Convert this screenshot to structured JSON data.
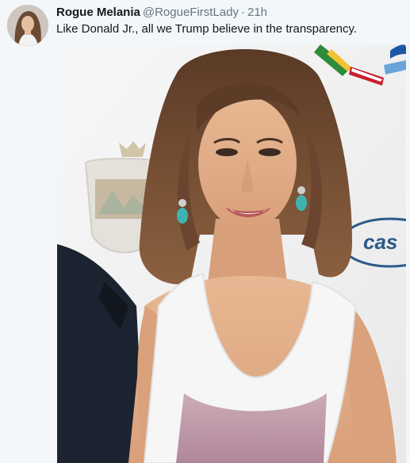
{
  "tweet": {
    "author_name": "Rogue Melania",
    "handle": "@RogueFirstLady",
    "separator": "·",
    "time": "21h",
    "text": "Like Donald Jr., all we Trump believe in the transparency."
  },
  "media": {
    "backdrop_text": "cas"
  },
  "colors": {
    "background": "#f4f7f9",
    "name": "#14171a",
    "secondary": "#657786"
  }
}
